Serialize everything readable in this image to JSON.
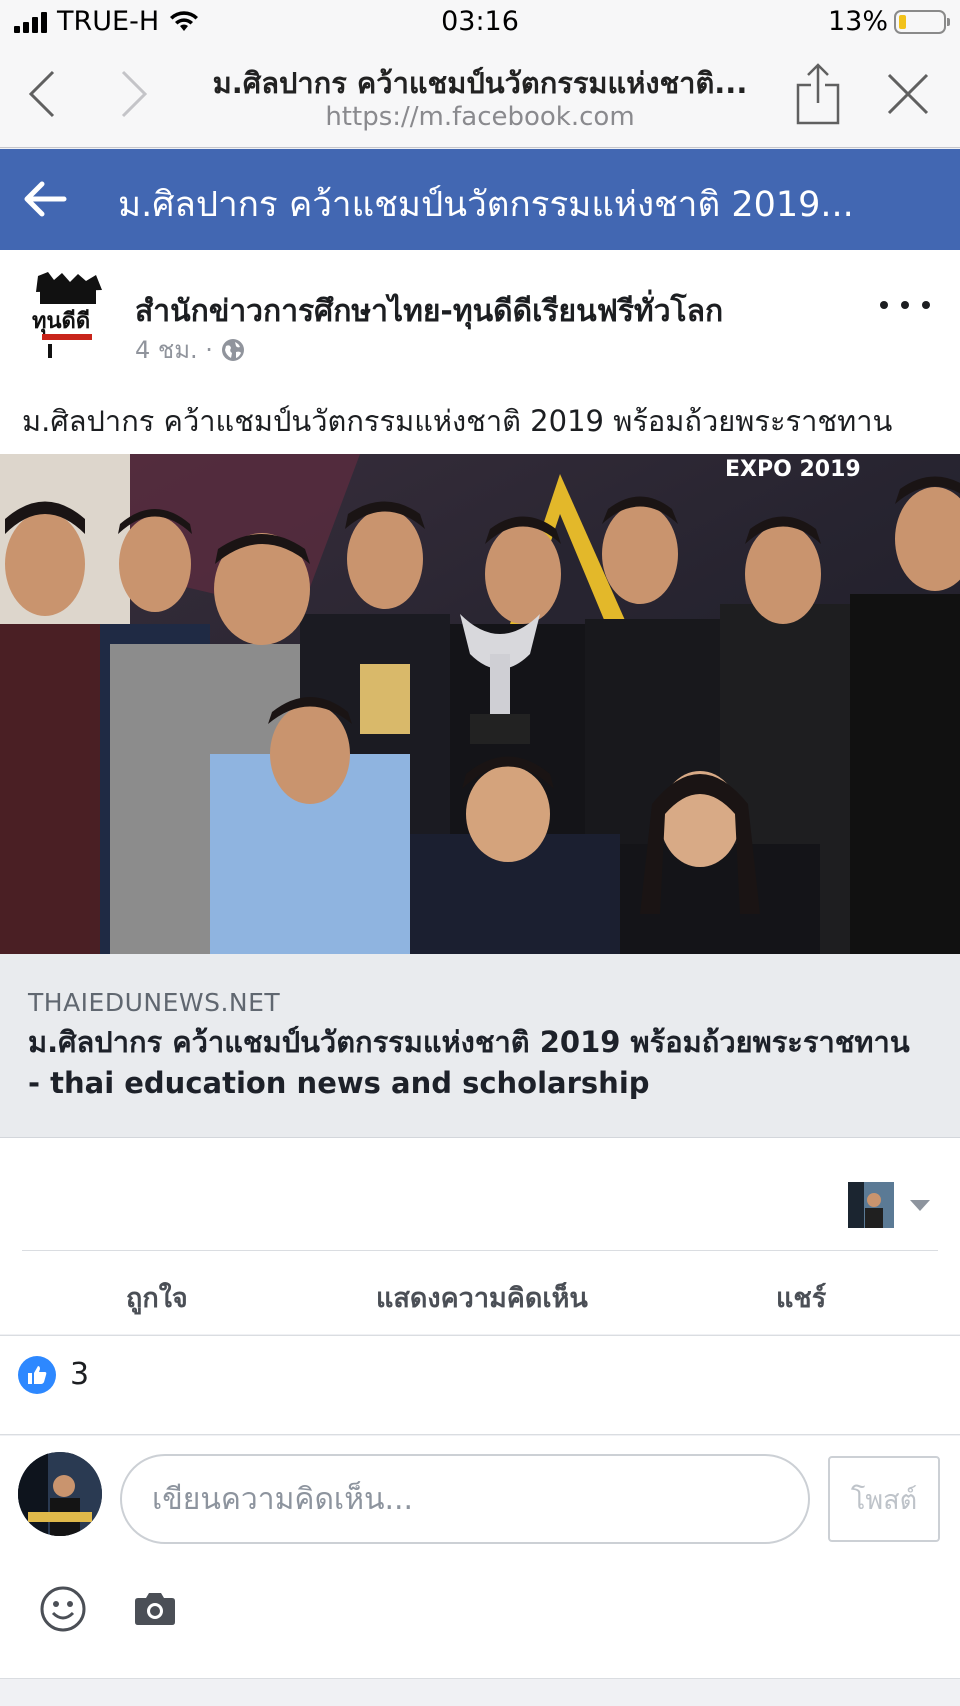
{
  "status_bar": {
    "carrier": "TRUE-H",
    "time": "03:16",
    "battery": "13%",
    "battery_level": 0.13
  },
  "browser": {
    "title": "ม.ศิลปากร คว้าแชมป์นวัตกรรมแห่งชาติ...",
    "url": "https://m.facebook.com"
  },
  "fb_header": {
    "title": "ม.ศิลปากร คว้าแชมป์นวัตกรรมแห่งชาติ 2019..."
  },
  "post": {
    "page_name": "สำนักข่าวการศึกษาไทย-ทุนดีดีเรียนฟรีทั่วโลก",
    "time": "4 ชม. ·",
    "text": "ม.ศิลปากร คว้าแชมป์นวัตกรรมแห่งชาติ 2019 พร้อมถ้วยพระราชทาน",
    "avatar_text": "ทุนดีดี",
    "photo_text": "EXPO 2019",
    "link": {
      "domain": "THAIEDUNEWS.NET",
      "title": "ม.ศิลปากร คว้าแชมป์นวัตกรรมแห่งชาติ 2019 พร้อมถ้วยพระราชทาน - thai education news and scholarship"
    }
  },
  "actions": {
    "like": "ถูกใจ",
    "comment": "แสดงความคิดเห็น",
    "share": "แชร์"
  },
  "reactions": {
    "count": "3"
  },
  "composer": {
    "placeholder": "เขียนความคิดเห็น...",
    "post_label": "โพสต์"
  },
  "colors": {
    "fb_blue": "#4267b2",
    "like_blue": "#2d88ff"
  }
}
